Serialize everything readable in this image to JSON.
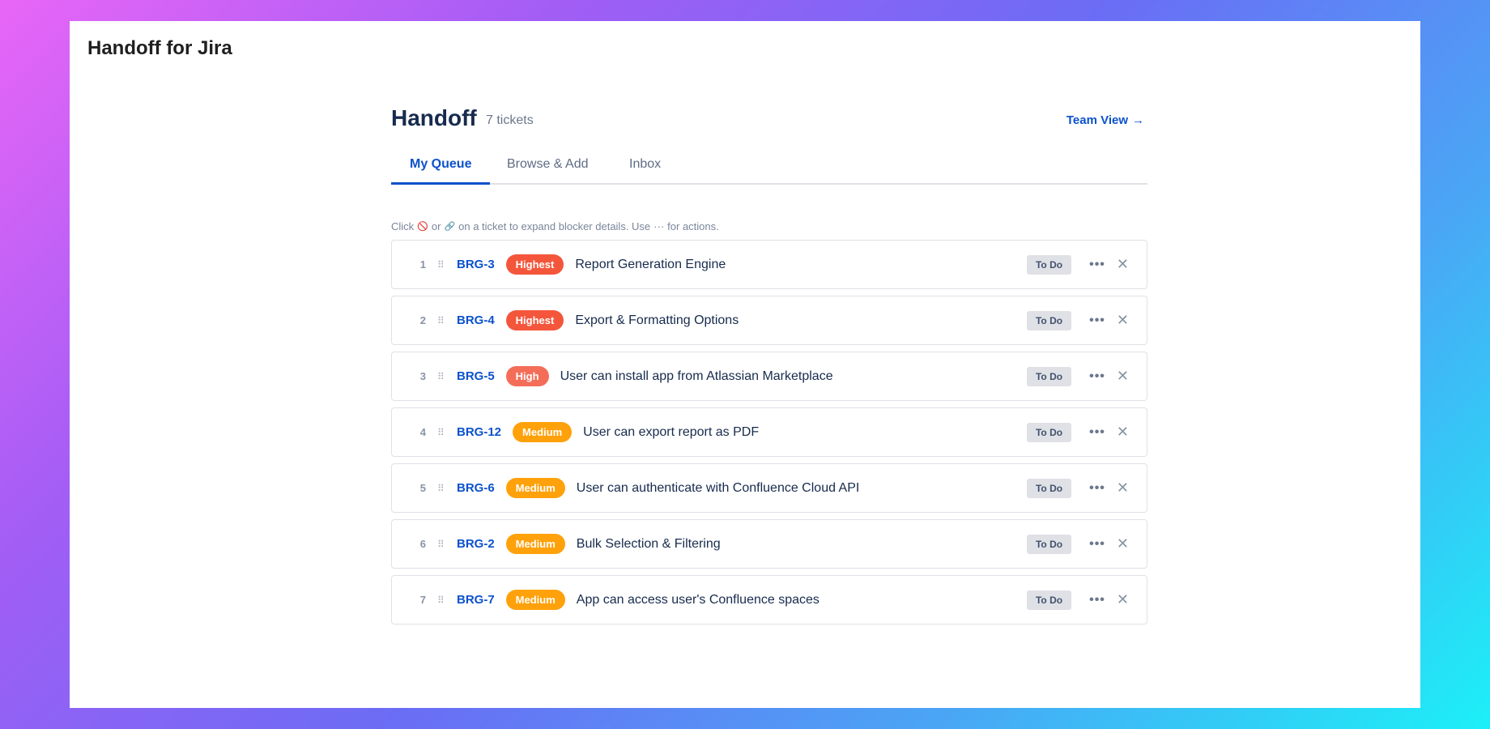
{
  "app": {
    "title": "Handoff for Jira"
  },
  "header": {
    "title": "Handoff",
    "ticket_count": "7 tickets",
    "team_view_label": "Team View",
    "team_view_arrow": "→"
  },
  "tabs": [
    {
      "label": "My Queue",
      "active": true
    },
    {
      "label": "Browse & Add",
      "active": false
    },
    {
      "label": "Inbox",
      "active": false
    }
  ],
  "hint": {
    "part1": "Click",
    "blocker_glyph": "🚫",
    "part2": "or",
    "link_glyph": "🔗",
    "part3": "on a ticket to expand blocker details. Use",
    "more_glyph": "···",
    "part4": "for actions."
  },
  "priority_colors": {
    "Highest": "#f4563b",
    "High": "#f46d58",
    "Medium": "#ffa10a"
  },
  "tickets": [
    {
      "num": "1",
      "key": "BRG-3",
      "priority": "Highest",
      "summary": "Report Generation Engine",
      "status": "To Do"
    },
    {
      "num": "2",
      "key": "BRG-4",
      "priority": "Highest",
      "summary": "Export & Formatting Options",
      "status": "To Do"
    },
    {
      "num": "3",
      "key": "BRG-5",
      "priority": "High",
      "summary": "User can install app from Atlassian Marketplace",
      "status": "To Do"
    },
    {
      "num": "4",
      "key": "BRG-12",
      "priority": "Medium",
      "summary": "User can export report as PDF",
      "status": "To Do"
    },
    {
      "num": "5",
      "key": "BRG-6",
      "priority": "Medium",
      "summary": "User can authenticate with Confluence Cloud API",
      "status": "To Do"
    },
    {
      "num": "6",
      "key": "BRG-2",
      "priority": "Medium",
      "summary": "Bulk Selection & Filtering",
      "status": "To Do"
    },
    {
      "num": "7",
      "key": "BRG-7",
      "priority": "Medium",
      "summary": "App can access user's Confluence spaces",
      "status": "To Do"
    }
  ],
  "row_actions": {
    "more_glyph": "•••",
    "remove_glyph": "✕",
    "drag_glyph": "⠿"
  }
}
